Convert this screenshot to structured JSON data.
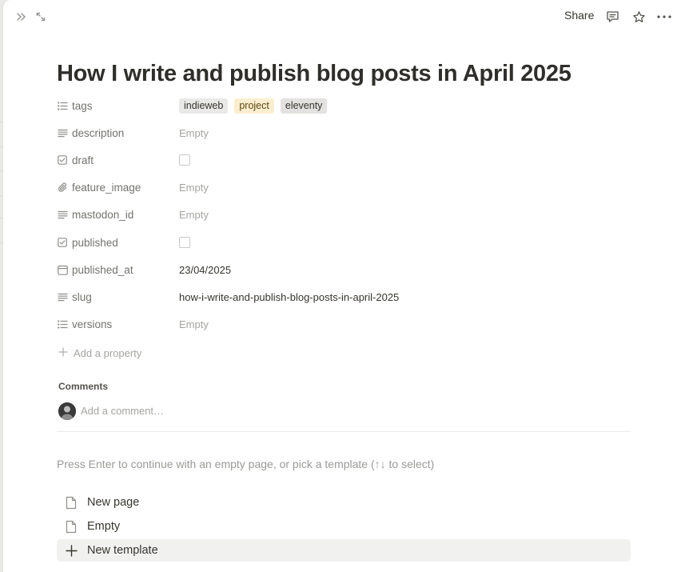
{
  "topbar": {
    "sidebar_toggle_icon": "double-chevron-right-icon",
    "expand_icon": "expand-arrows-icon",
    "share_label": "Share",
    "comment_icon": "comment-icon",
    "favorite_icon": "star-icon",
    "more_icon": "ellipsis-icon"
  },
  "page": {
    "title": "How I write and publish blog posts in April 2025"
  },
  "properties": [
    {
      "key": "tags",
      "icon": "list-icon",
      "type": "multi_select",
      "tags": [
        {
          "label": "indieweb",
          "bg": "#e9e9e7",
          "color": "#37352f"
        },
        {
          "label": "project",
          "bg": "#fbeecf",
          "color": "#5c4613"
        },
        {
          "label": "eleventy",
          "bg": "#e3e2e0",
          "color": "#37352f"
        }
      ]
    },
    {
      "key": "description",
      "icon": "text-icon",
      "type": "text",
      "value": "Empty",
      "empty": true
    },
    {
      "key": "draft",
      "icon": "checkbox-icon",
      "type": "checkbox",
      "checked": false
    },
    {
      "key": "feature_image",
      "icon": "paperclip-icon",
      "type": "text",
      "value": "Empty",
      "empty": true
    },
    {
      "key": "mastodon_id",
      "icon": "text-icon",
      "type": "text",
      "value": "Empty",
      "empty": true
    },
    {
      "key": "published",
      "icon": "checkbox-icon",
      "type": "checkbox",
      "checked": false
    },
    {
      "key": "published_at",
      "icon": "calendar-icon",
      "type": "text",
      "value": "23/04/2025",
      "empty": false
    },
    {
      "key": "slug",
      "icon": "text-icon",
      "type": "text",
      "value": "how-i-write-and-publish-blog-posts-in-april-2025",
      "empty": false
    },
    {
      "key": "versions",
      "icon": "list-icon",
      "type": "text",
      "value": "Empty",
      "empty": true
    }
  ],
  "add_property": {
    "label": "Add a property",
    "icon": "plus-icon"
  },
  "comments": {
    "heading": "Comments",
    "placeholder": "Add a comment…",
    "avatar_icon": "user-avatar"
  },
  "template_hint": "Press Enter to continue with an empty page, or pick a template (↑↓ to select)",
  "templates": [
    {
      "label": "New page",
      "icon": "page-icon",
      "active": false
    },
    {
      "label": "Empty",
      "icon": "page-icon",
      "active": false
    },
    {
      "label": "New template",
      "icon": "plus-icon",
      "active": true
    }
  ],
  "colors": {
    "text": "#37352f",
    "muted": "#73726e",
    "placeholder": "#a5a4a1",
    "hover_bg": "#f1f1ef"
  }
}
